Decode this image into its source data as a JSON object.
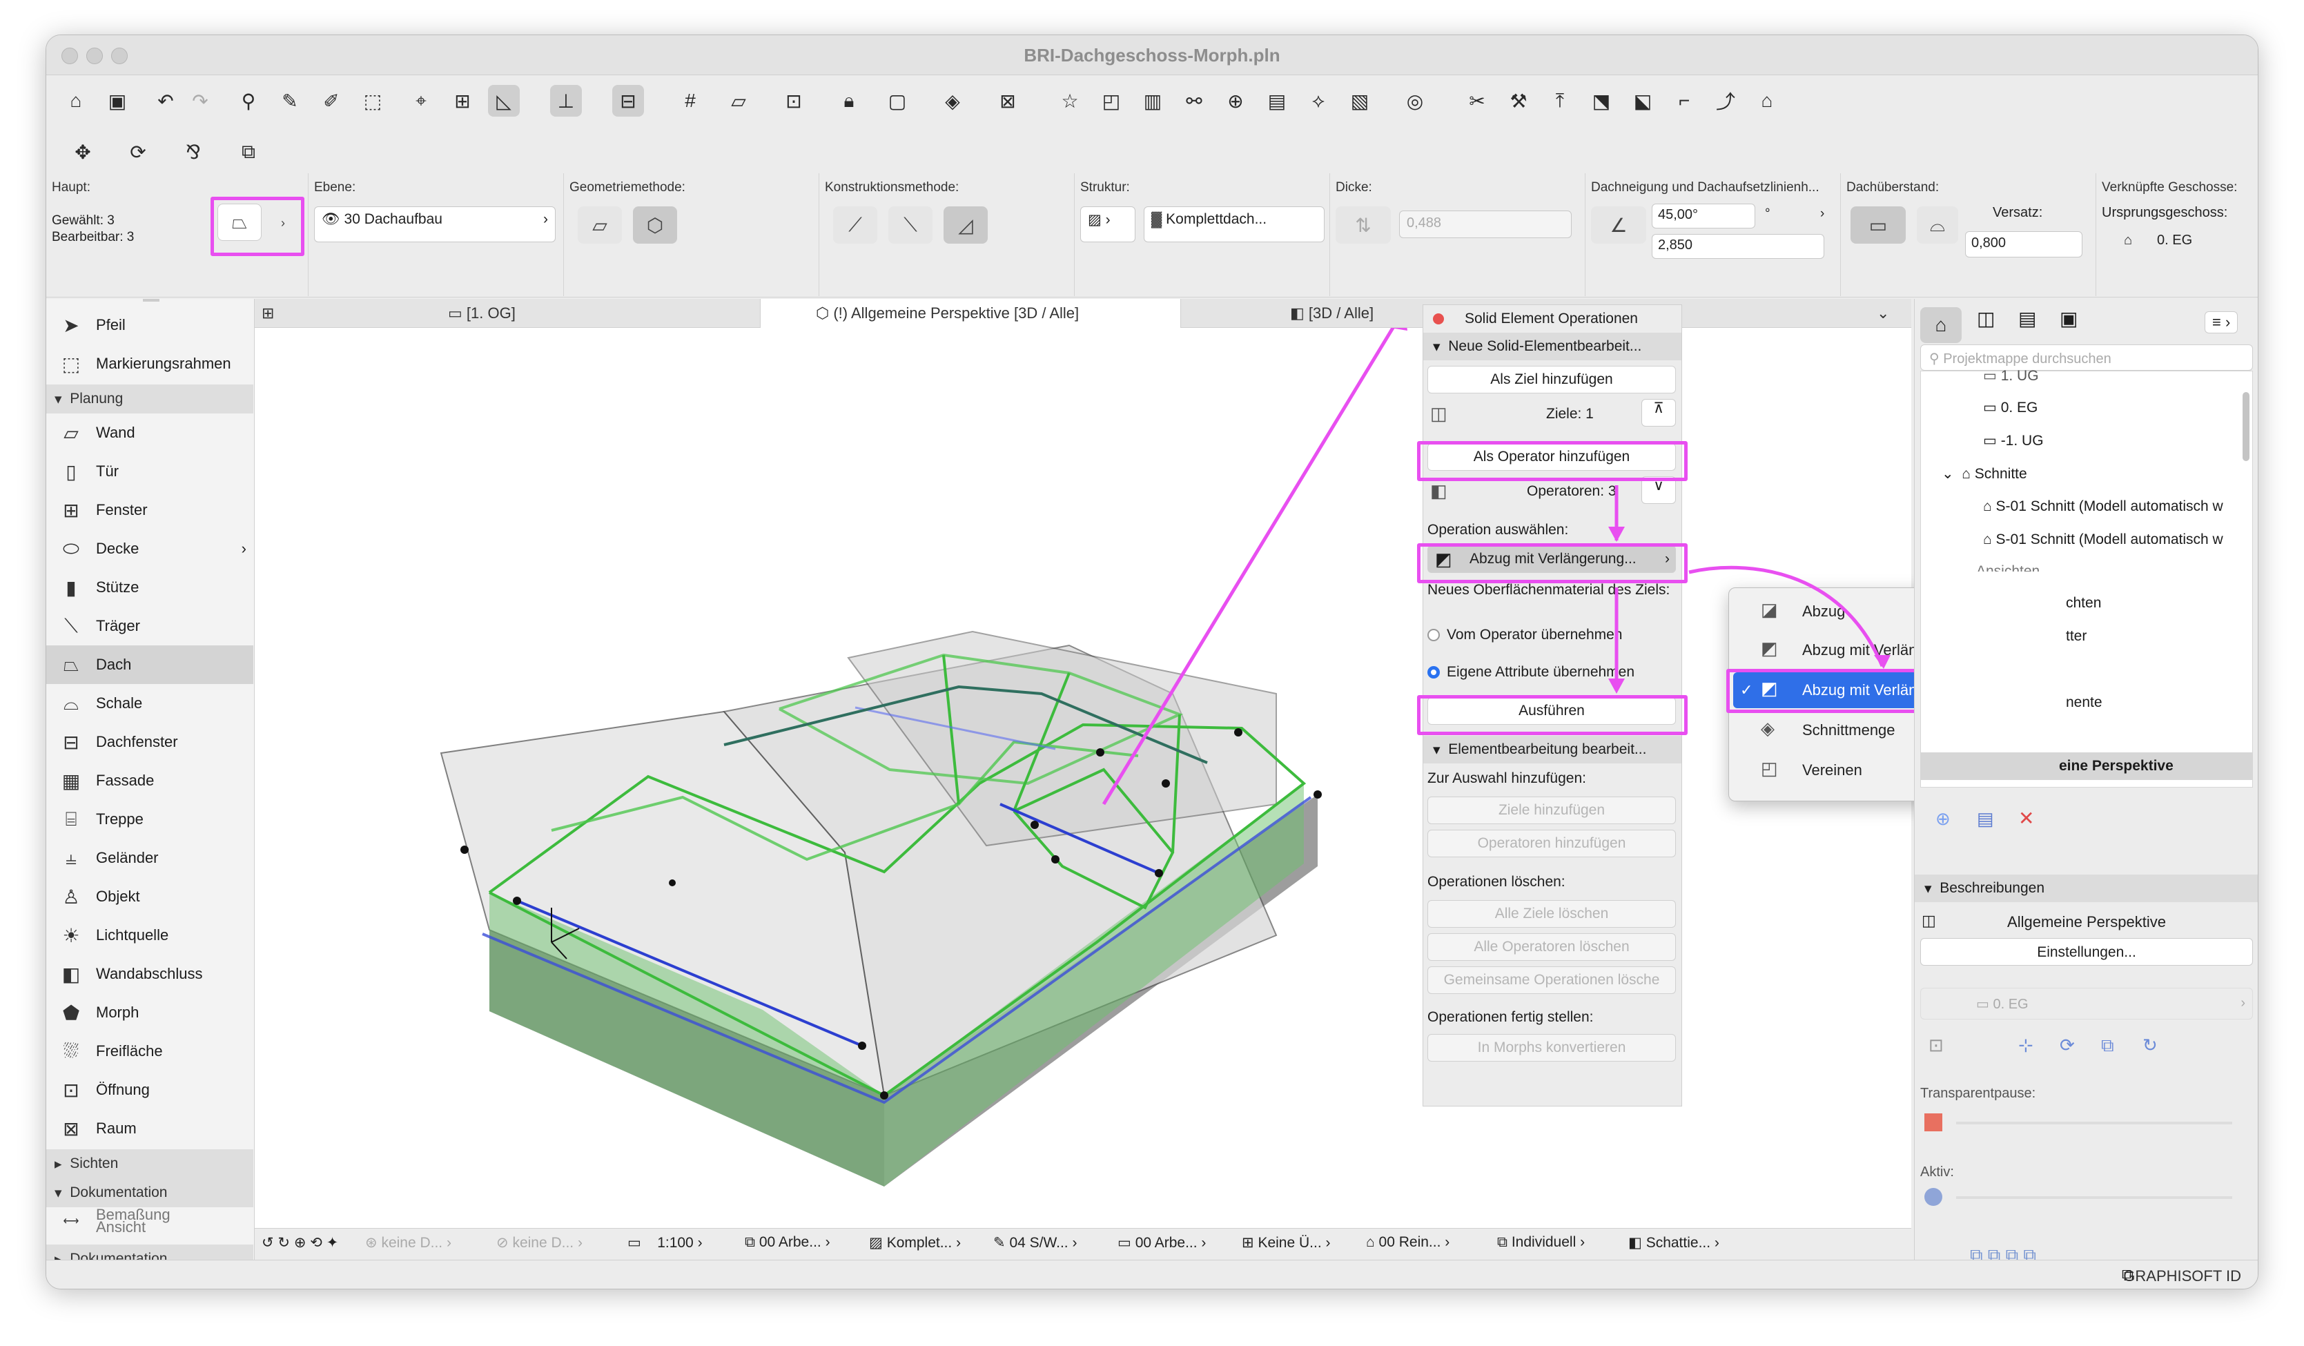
{
  "window": {
    "title": "BRI-Dachgeschoss-Morph.pln"
  },
  "info": {
    "haupt_label": "Haupt:",
    "selected": "Gewählt: 3",
    "editable": "Bearbeitbar: 3",
    "ebene_label": "Ebene:",
    "ebene_value": "30 Dachaufbau",
    "geometrie_label": "Geometriemethode:",
    "konstruktion_label": "Konstruktionsmethode:",
    "struktur_label": "Struktur:",
    "struktur_value": "Komplettdach...",
    "dicke_label": "Dicke:",
    "dicke_value": "0,488",
    "dachneigung_label": "Dachneigung und Dachaufsetzlinienh...",
    "angle_value": "45,00°",
    "angle_unit": "°",
    "height_value": "2,850",
    "ueberstand_label": "Dachüberstand:",
    "versatz_label": "Versatz:",
    "versatz_value": "0,800",
    "geschoss_label": "Verknüpfte Geschosse:",
    "ursprung_label": "Ursprungsgeschoss:",
    "ursprung_value": "0. EG"
  },
  "tabs": [
    {
      "label": "[1. OG]"
    },
    {
      "label": "(!) Allgemeine Perspektive [3D / Alle]"
    },
    {
      "label": "[3D / Alle]"
    }
  ],
  "sidebar": {
    "tools_top": [
      {
        "label": "Pfeil",
        "icon": "arrow-icon"
      },
      {
        "label": "Markierungsrahmen",
        "icon": "marquee-icon"
      }
    ],
    "cat_planung": "Planung",
    "items": [
      {
        "label": "Wand"
      },
      {
        "label": "Tür"
      },
      {
        "label": "Fenster"
      },
      {
        "label": "Decke"
      },
      {
        "label": "Stütze"
      },
      {
        "label": "Träger"
      },
      {
        "label": "Dach"
      },
      {
        "label": "Schale"
      },
      {
        "label": "Dachfenster"
      },
      {
        "label": "Fassade"
      },
      {
        "label": "Treppe"
      },
      {
        "label": "Geländer"
      },
      {
        "label": "Objekt"
      },
      {
        "label": "Lichtquelle"
      },
      {
        "label": "Wandabschluss"
      },
      {
        "label": "Morph"
      },
      {
        "label": "Freifläche"
      },
      {
        "label": "Öffnung"
      },
      {
        "label": "Raum"
      }
    ],
    "cat_sichten": "Sichten",
    "cat_doku": "Dokumentation",
    "doc_item": "Bemaßung",
    "doc_item2": "Ansicht",
    "cat_doku2": "Dokumentation"
  },
  "panel": {
    "title": "Solid Element Operationen",
    "section1": "Neue Solid-Elementbearbeit...",
    "add_target": "Als Ziel hinzufügen",
    "targets": "Ziele: 1",
    "add_operator": "Als Operator hinzufügen",
    "operators": "Operatoren: 3",
    "choose_op": "Operation auswählen:",
    "op_selected": "Abzug mit Verlängerung...",
    "new_material": "Neues Oberflächenmaterial des Ziels:",
    "radio1": "Vom Operator übernehmen",
    "radio2": "Eigene Attribute übernehmen",
    "execute": "Ausführen",
    "section2": "Elementbearbeitung bearbeit...",
    "add_sel": "Zur Auswahl hinzufügen:",
    "add_targets": "Ziele hinzufügen",
    "add_ops": "Operatoren hinzufügen",
    "delete_ops": "Operationen löschen:",
    "del_targets": "Alle Ziele löschen",
    "del_ops": "Alle Operatoren löschen",
    "del_common": "Gemeinsame Operationen lösche",
    "finish": "Operationen fertig stellen:",
    "convert": "In Morphs konvertieren"
  },
  "menu": {
    "items": [
      {
        "label": "Abzug"
      },
      {
        "label": "Abzug mit Verlängerung nach oben"
      },
      {
        "label": "Abzug mit Verlängerung nach unten",
        "checked": "✓"
      },
      {
        "label": "Schnittmenge"
      },
      {
        "label": "Vereinen"
      }
    ]
  },
  "right": {
    "search_placeholder": "Projektmappe durchsuchen",
    "tree": [
      {
        "label": "1. UG"
      },
      {
        "label": "0. EG"
      },
      {
        "label": "-1. UG"
      },
      {
        "label": "Schnitte"
      },
      {
        "label": "S-01 Schnitt (Modell automatisch w"
      },
      {
        "label": "S-01 Schnitt (Modell automatisch w"
      },
      {
        "label": "Ansichten"
      },
      {
        "label": "chten"
      },
      {
        "label": "tter"
      },
      {
        "label": "nente"
      }
    ],
    "selected_view": "eine Perspektive",
    "beschreibungen": "Beschreibungen",
    "view_name": "Allgemeine Perspektive",
    "einstellungen": "Einstellungen...",
    "story": "0. EG",
    "transparent": "Transparentpause:",
    "aktiv": "Aktiv:"
  },
  "status": {
    "a": "keine D...",
    "b": "keine D...",
    "scale": "1:100",
    "c": "00 Arbe...",
    "d": "Komplet...",
    "e": "04 S/W...",
    "f": "00 Arbe...",
    "g": "Keine Ü...",
    "h": "00 Rein...",
    "i": "Individuell",
    "j": "Schattie..."
  },
  "footer": {
    "brand": "GRAPHISOFT ID"
  },
  "colors": {
    "highlight": "#e84ff0",
    "selection": "#2f6fe8",
    "roof_green": "#3dbb3d",
    "operator_blue": "#2c3fd0"
  }
}
